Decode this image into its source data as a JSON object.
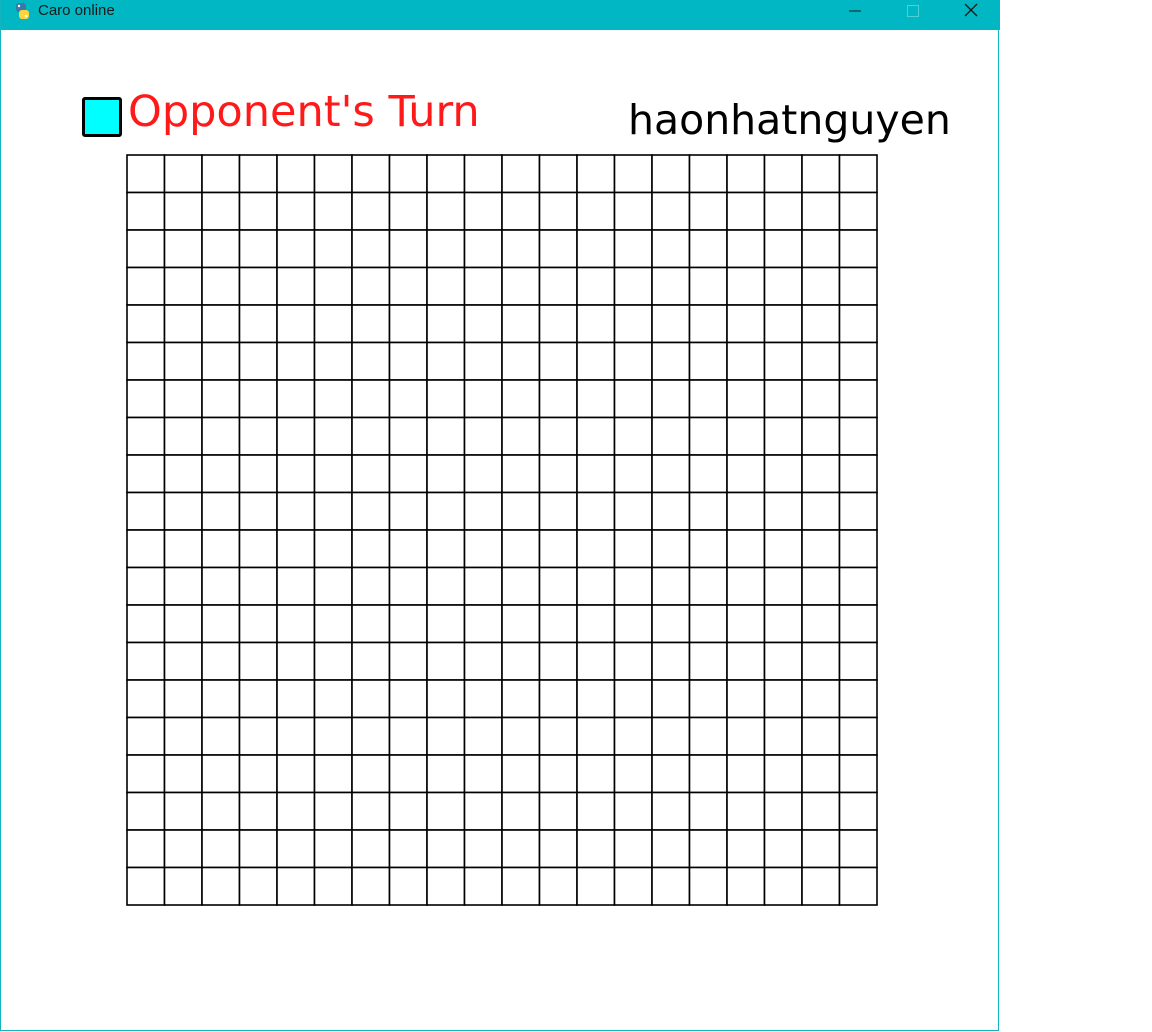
{
  "window": {
    "title": "Caro online",
    "icon": "python-snake-icon",
    "controls": {
      "minimize": "minimize-icon",
      "maximize": "maximize-icon",
      "close": "close-icon"
    }
  },
  "game": {
    "turn_text": "Opponent's Turn",
    "turn_color": "#ff1a1a",
    "player_marker_color": "#00ffff",
    "username": "haonhatnguyen",
    "board": {
      "rows": 20,
      "cols": 20,
      "cells": []
    }
  }
}
